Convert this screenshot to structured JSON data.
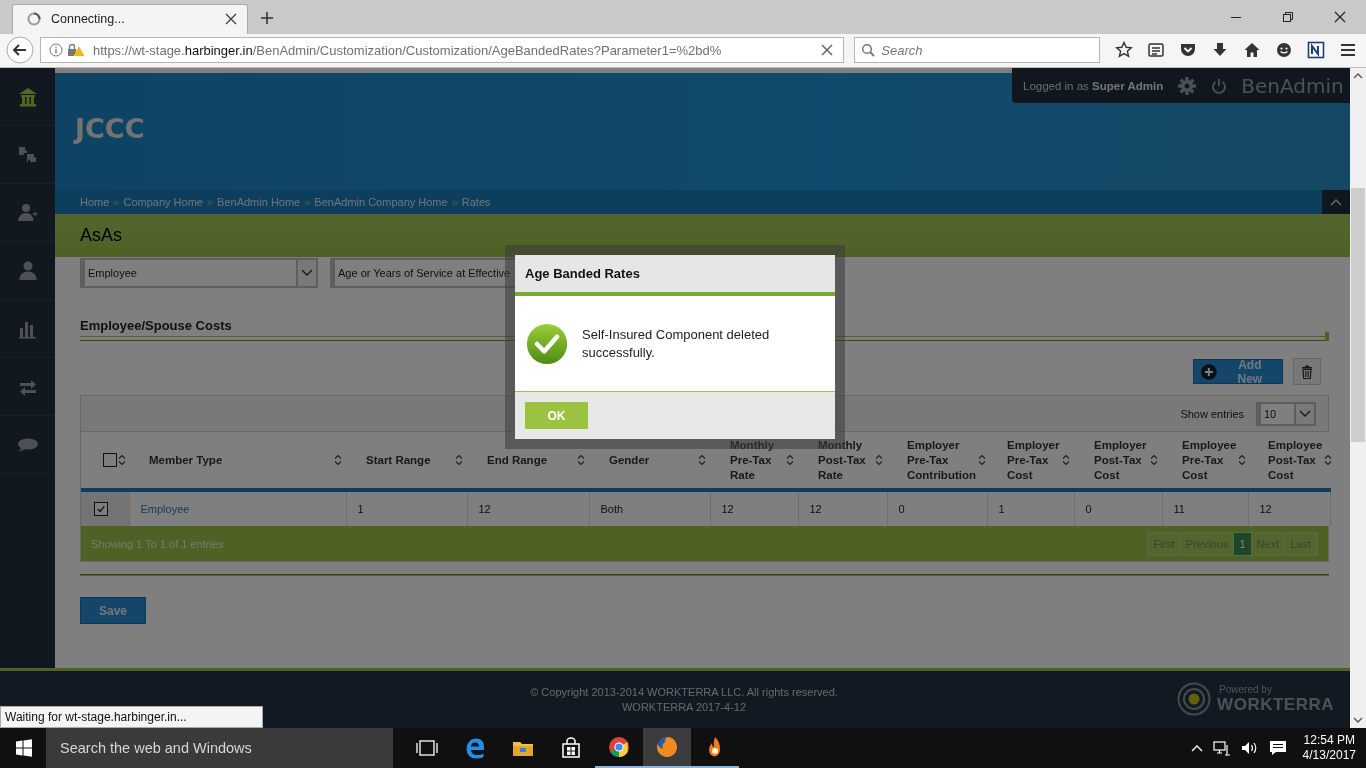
{
  "browser": {
    "tab": {
      "title": "Connecting..."
    },
    "address": {
      "prefix": "https://wt-stage.",
      "domain": "harbinger.in",
      "path": "/BenAdmin/Customization/Customization/AgeBandedRates?Parameter1=%2bd%"
    },
    "search": {
      "placeholder": "Search"
    }
  },
  "sidebar": {
    "items": [
      {
        "kind": "home",
        "selected": true
      },
      {
        "kind": "puzzle",
        "selected": false
      },
      {
        "kind": "user-star",
        "selected": false
      },
      {
        "kind": "user",
        "selected": false
      },
      {
        "kind": "chart",
        "selected": false
      },
      {
        "kind": "transfer",
        "selected": false
      },
      {
        "kind": "chat",
        "selected": false
      }
    ]
  },
  "header": {
    "title": "JCCC",
    "user": "Logged in as **Super Admin**",
    "app_name": "BenAdmin"
  },
  "breadcrumbs": [
    {
      "label": "Home"
    },
    {
      "separator": "»",
      "label": "Company Home"
    },
    {
      "separator": "»",
      "label": "BenAdmin Home"
    },
    {
      "separator": "»",
      "label": "BenAdmin Company Home"
    },
    {
      "separator": "»",
      "label": "Rates"
    }
  ],
  "page_title": "AsAs",
  "filters": [
    {
      "value": "Employee"
    },
    {
      "value": "Age or Years of Service at Effective"
    }
  ],
  "section": {
    "title": "Employee/Spouse Costs",
    "add_button": "Add New"
  },
  "table": {
    "show_entries_label": "Show entries",
    "page_size": "10",
    "header_checked": false,
    "columns": [
      "Member Type",
      "Start Range",
      "End Range",
      "Gender",
      "Monthly Pre-Tax Rate",
      "Monthly Post-Tax Rate",
      "Employer Pre-Tax Contribution",
      "Employer Pre-Tax Cost",
      "Employer Post-Tax Cost",
      "Employee Pre-Tax Cost",
      "Employee Post-Tax Cost"
    ],
    "rows": [
      {
        "checked": true,
        "cells": [
          "Employee",
          "1",
          "12",
          "Both",
          "12",
          "12",
          "0",
          "1",
          "0",
          "11",
          "12"
        ]
      }
    ],
    "info": "Showing 1 To 1 of 1 entries",
    "pagination": [
      {
        "label": "First",
        "selected": false
      },
      {
        "label": "Previous",
        "selected": false
      },
      {
        "label": "1",
        "selected": true
      },
      {
        "label": "Next",
        "selected": false
      },
      {
        "label": "Last",
        "selected": false
      }
    ]
  },
  "save_button": "Save",
  "footer": {
    "copyright": "© Copyright 2013-2014 WORKTERRA LLC. All rights reserved.",
    "version": "WORKTERRA 2017-4-12",
    "powered_by": "Powered by",
    "brand": "WORKTERRA"
  },
  "dialog": {
    "title": "Age Banded Rates",
    "message": "Self-Insured Component deleted successfully.",
    "ok": "OK"
  },
  "status_tooltip": "Waiting for wt-stage.harbinger.in...",
  "taskbar": {
    "search_placeholder": "Search the web and Windows",
    "apps": [
      {
        "kind": "task-view",
        "selected": false,
        "running": false
      },
      {
        "kind": "edge",
        "selected": false,
        "running": false
      },
      {
        "kind": "explorer",
        "selected": false,
        "running": false
      },
      {
        "kind": "store",
        "selected": false,
        "running": false
      },
      {
        "kind": "chrome",
        "selected": false,
        "running": true
      },
      {
        "kind": "firefox",
        "selected": true,
        "running": true
      },
      {
        "kind": "flame",
        "selected": false,
        "running": true
      }
    ],
    "time": "12:54 PM",
    "date": "4/13/2017"
  }
}
